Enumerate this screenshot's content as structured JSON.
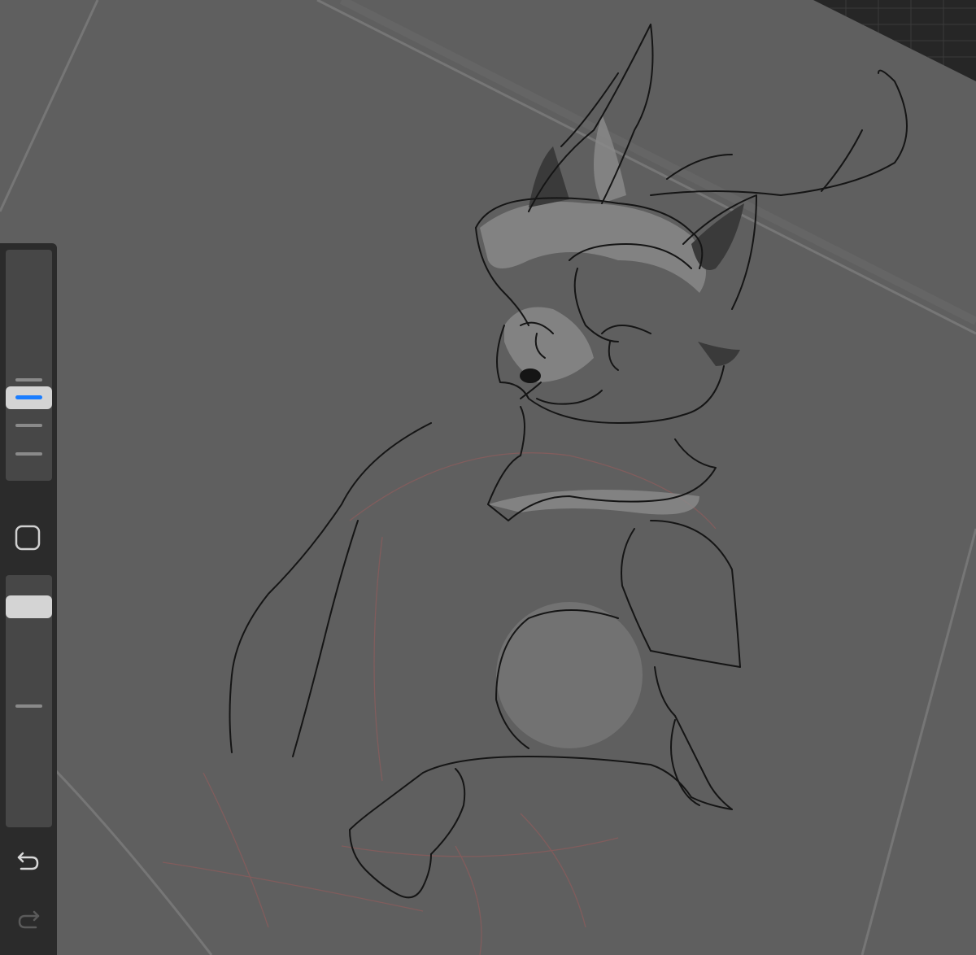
{
  "app": {
    "accent_color": "#1a7dff",
    "canvas_color": "#5f5f5f",
    "sidebar_color": "#2b2b2b"
  },
  "sidebar": {
    "brush_size": {
      "level": 0.64
    },
    "modify_button": {
      "icon": "square-outline-icon"
    },
    "brush_opacity": {
      "level": 0.95
    },
    "undo": {
      "icon": "undo-arrow-icon"
    },
    "redo": {
      "icon": "redo-arrow-icon",
      "enabled": false
    }
  },
  "corner_grid": {
    "icon": "grid-icon"
  }
}
